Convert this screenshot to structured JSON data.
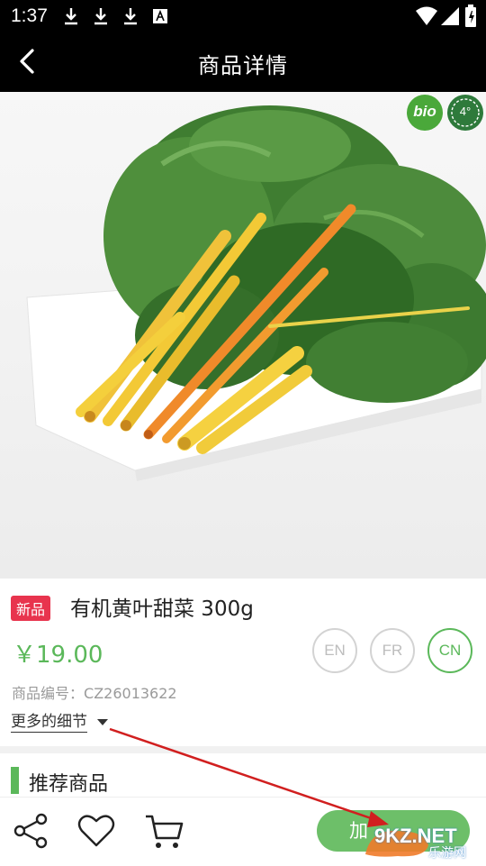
{
  "status_bar": {
    "time": "1:37"
  },
  "app_bar": {
    "title": "商品详情"
  },
  "product": {
    "tag": "新品",
    "name": "有机黄叶甜菜 300g",
    "price": "￥19.00",
    "languages": [
      "EN",
      "FR",
      "CN"
    ],
    "selected_language": "CN",
    "sku_label": "商品编号：",
    "sku_value": "CZ26013622",
    "more_details": "更多的细节",
    "badges": {
      "bio": "bio",
      "temperature": "4°"
    }
  },
  "recommend": {
    "title": "推荐商品"
  },
  "bottom_bar": {
    "add_to_cart": "加"
  },
  "watermark": {
    "brand": "9KZ.NET",
    "sub": "乐游网"
  },
  "colors": {
    "accent": "#5bb85a",
    "tag_red": "#e8344e",
    "bar": "#000000",
    "arrow": "#d11f1f"
  }
}
